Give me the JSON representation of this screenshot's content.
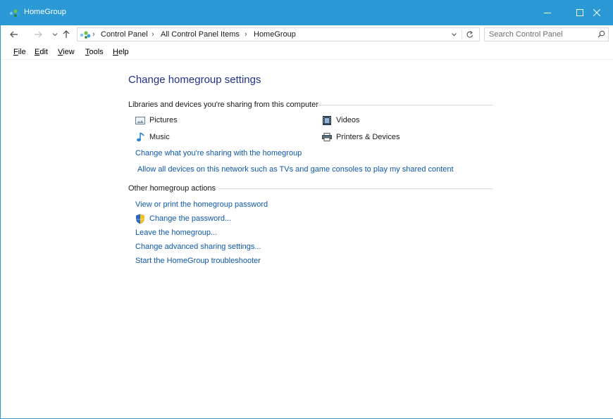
{
  "window": {
    "title": "HomeGroup"
  },
  "address_bar": {
    "crumbs": [
      "Control Panel",
      "All Control Panel Items",
      "HomeGroup"
    ],
    "separator": "›"
  },
  "search": {
    "placeholder": "Search Control Panel"
  },
  "menu": {
    "items": [
      {
        "accel": "F",
        "rest": "ile"
      },
      {
        "accel": "E",
        "rest": "dit"
      },
      {
        "accel": "V",
        "rest": "iew"
      },
      {
        "accel": "T",
        "rest": "ools"
      },
      {
        "accel": "H",
        "rest": "elp"
      }
    ]
  },
  "main": {
    "title": "Change homegroup settings",
    "sharing_section": {
      "heading": "Libraries and devices you're sharing from this computer",
      "items": [
        {
          "label": "Pictures",
          "icon": "pictures-icon"
        },
        {
          "label": "Videos",
          "icon": "videos-icon"
        },
        {
          "label": "Music",
          "icon": "music-icon"
        },
        {
          "label": "Printers & Devices",
          "icon": "printer-icon"
        }
      ],
      "links": [
        "Change what you're sharing with the homegroup",
        "Allow all devices on this network such as TVs and game consoles to play my shared content"
      ]
    },
    "actions_section": {
      "heading": "Other homegroup actions",
      "links": [
        "View or print the homegroup password",
        "Change the password...",
        "Leave the homegroup...",
        "Change advanced sharing settings...",
        "Start the HomeGroup troubleshooter"
      ]
    }
  },
  "colors": {
    "titlebar": "#2b99d6",
    "link": "#0e57a8",
    "title_text": "#1e3287"
  }
}
